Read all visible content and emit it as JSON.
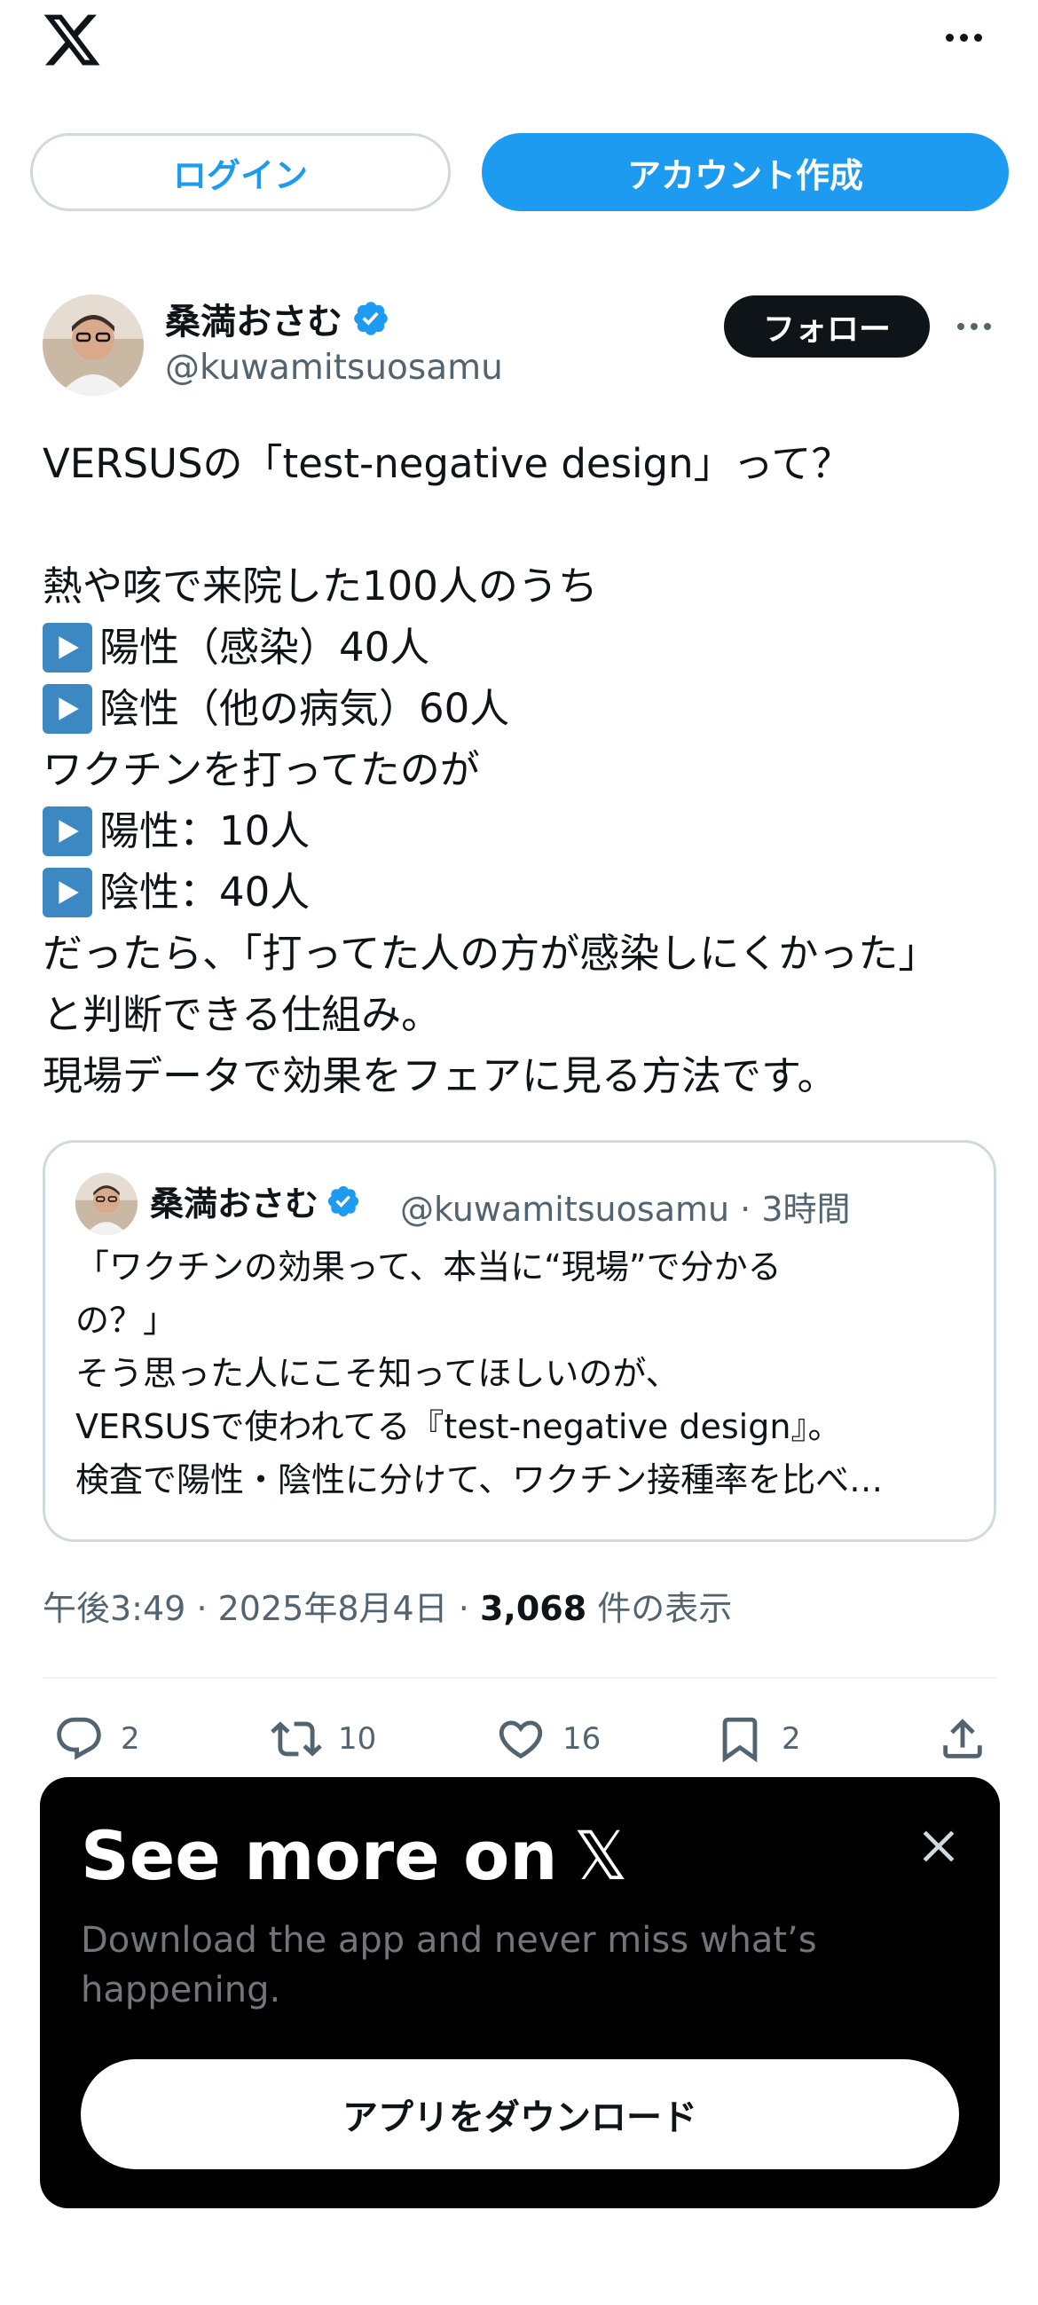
{
  "header": {
    "logo_icon": "x-logo-icon",
    "more_icon": "more-horizontal-icon"
  },
  "auth": {
    "login_label": "ログイン",
    "signup_label": "アカウント作成"
  },
  "post": {
    "author": {
      "name": "桑満おさむ",
      "handle": "@kuwamitsuosamu",
      "verified": true
    },
    "follow_label": "フォロー",
    "text_lines": [
      "VERSUSの「test-negative design」って？",
      "",
      "熱や咳で来院した100人のうち",
      "陽性（感染）40人",
      "陰性（他の病気）60人",
      "ワクチンを打ってたのが",
      "陽性：10人",
      "陰性：40人",
      "だったら、「打ってた人の方が感染しにくかった」",
      "と判断できる仕組み。",
      "現場データで効果をフェアに見る方法です。"
    ],
    "quote": {
      "name": "桑満おさむ",
      "handle_time": "@kuwamitsuosamu · 3時間",
      "lines": [
        "「ワクチンの効果って、本当に“現場”で分かる",
        "の？」",
        "そう思った人にこそ知ってほしいのが、",
        "VERSUSで使われてる『test-negative design』。",
        "検査で陽性・陰性に分けて、ワクチン接種率を比べ…"
      ]
    },
    "meta": {
      "time": "午後3:49",
      "date": "2025年8月4日",
      "views": "3,068",
      "views_suffix": "件の表示",
      "separator": "·"
    },
    "actions": {
      "replies": "2",
      "reposts": "10",
      "likes": "16",
      "bookmarks": "2"
    }
  },
  "sheet": {
    "title": "See more on",
    "title_logo": "𝕏",
    "subtitle": "Download the app and never miss what’s happening.",
    "button_label": "アプリをダウンロード"
  },
  "colors": {
    "accent": "#1d9bf0",
    "text": "#0f1419",
    "secondary": "#536471",
    "border": "#cfd9de",
    "verified": "#1d9bf0",
    "play_emoji": "#3b88c3"
  }
}
